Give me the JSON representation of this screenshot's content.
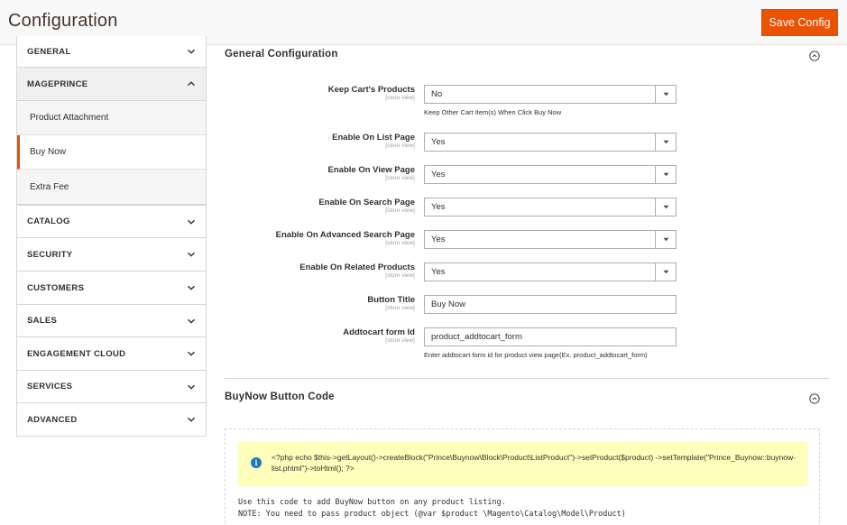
{
  "header": {
    "title": "Configuration",
    "save_label": "Save Config"
  },
  "sidebar": {
    "general": "GENERAL",
    "mageprince": "MAGEPRINCE",
    "mageprince_items": [
      "Product Attachment",
      "Buy Now",
      "Extra Fee"
    ],
    "active_item": "Buy Now",
    "sections": [
      "CATALOG",
      "SECURITY",
      "CUSTOMERS",
      "SALES",
      "ENGAGEMENT CLOUD",
      "SERVICES",
      "ADVANCED"
    ]
  },
  "general_config": {
    "title": "General Configuration",
    "fields": [
      {
        "label": "Keep Cart's Products",
        "scope": "[store view]",
        "value": "No",
        "type": "select",
        "note": "Keep Other Cart Item(s) When Click Buy Now"
      },
      {
        "label": "Enable On List Page",
        "scope": "[store view]",
        "value": "Yes",
        "type": "select"
      },
      {
        "label": "Enable On View Page",
        "scope": "[store view]",
        "value": "Yes",
        "type": "select"
      },
      {
        "label": "Enable On Search Page",
        "scope": "[store view]",
        "value": "Yes",
        "type": "select"
      },
      {
        "label": "Enable On Advanced Search Page",
        "scope": "[store view]",
        "value": "Yes",
        "type": "select"
      },
      {
        "label": "Enable On Related Products",
        "scope": "[store view]",
        "value": "Yes",
        "type": "select"
      },
      {
        "label": "Button Title",
        "scope": "[store view]",
        "value": "Buy Now",
        "type": "text"
      },
      {
        "label": "Addtocart form Id",
        "scope": "[store view]",
        "value": "product_addtocart_form",
        "type": "text",
        "note": "Enter addtocart form id for product view page(Ex. product_addtocart_form)"
      }
    ]
  },
  "buynow_code": {
    "title": "BuyNow Button Code",
    "code": "<?php echo $this->getLayout()->createBlock(\"Prince\\Buynow\\Block\\Product\\ListProduct\")->setProduct($product) ->setTemplate(\"Prince_Buynow::buynow-list.phtml\")->toHtml(); ?>",
    "usage_line1": "Use this code to add BuyNow button on any product listing.",
    "usage_line2": "NOTE: You need to pass product object (@var $product \\Magento\\Catalog\\Model\\Product)"
  },
  "colors": {
    "accent": "#eb5202",
    "notice_bg": "#ffffbb",
    "info_icon": "#1979c3"
  }
}
